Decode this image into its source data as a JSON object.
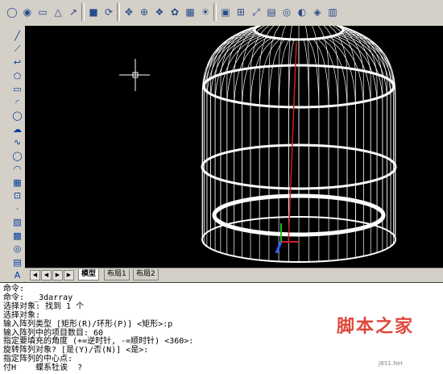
{
  "toolbar": {
    "icons": [
      "circle-icon",
      "globe-icon",
      "cylinder-icon",
      "cone-icon",
      "arrow-icon",
      "box-icon",
      "rotate-icon",
      "pan-icon",
      "zoom-icon",
      "render-icon",
      "palette-icon",
      "material-icon",
      "light-icon",
      "view-icon",
      "zoom-window-icon",
      "zoom-extents-icon",
      "layer-icon",
      "orbit-icon",
      "shade-icon",
      "camera-icon",
      "properties-icon"
    ]
  },
  "left_tools": [
    "line",
    "xline",
    "pline",
    "polygon",
    "rectangle",
    "arc",
    "circle",
    "revcloud",
    "spline",
    "ellipse",
    "ellipse-arc",
    "block",
    "insert",
    "point",
    "hatch",
    "gradient",
    "region",
    "table",
    "mtext"
  ],
  "tabs": {
    "model": "模型",
    "layout1": "布局1",
    "layout2": "布局2"
  },
  "command_history": [
    "命令:",
    "命令:  _3darray",
    "选择对象: 找到 1 个",
    "选择对象:",
    "输入阵列类型 [矩形(R)/环形(P)] <矩形>:p",
    "输入阵列中的项目数目: 60",
    "指定要填充的角度 (+=逆时针, -=顺时针) <360>:",
    "旋转阵列对象? [是(Y)/否(N)] <是>:",
    "指定阵列的中心点:",
    "付H    蝶系牡诶  ?"
  ],
  "watermark": {
    "text": "脚本之家",
    "sub": "JB51.Net"
  },
  "colors": {
    "viewport_bg": "#000000",
    "wireframe": "#ffffff",
    "axis_red": "#d02020",
    "axis_green": "#20c020",
    "axis_blue": "#3060ff"
  }
}
